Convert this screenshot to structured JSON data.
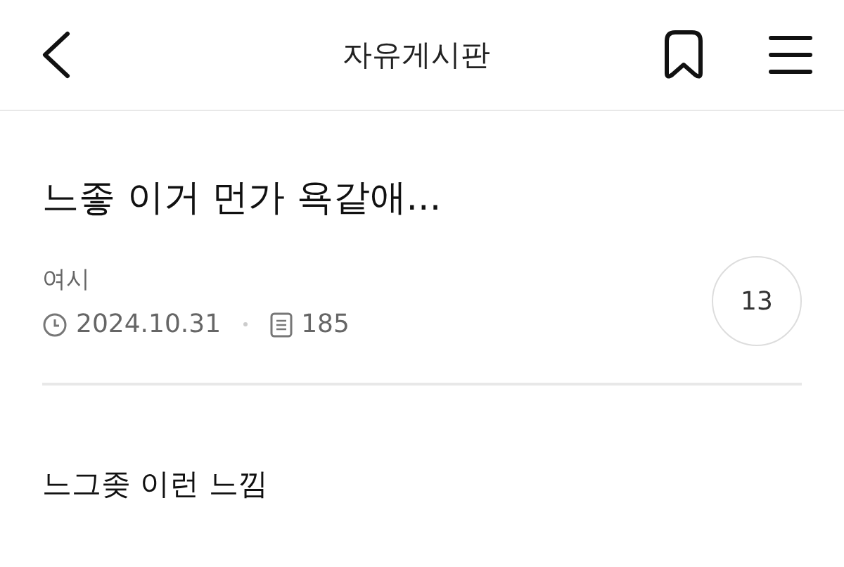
{
  "header": {
    "title": "자유게시판"
  },
  "post": {
    "title": "느좋 이거 먼가 욕같애...",
    "author": "여시",
    "date": "2024.10.31",
    "views": "185",
    "comments": "13",
    "body": "느그좆 이런 느낌"
  }
}
